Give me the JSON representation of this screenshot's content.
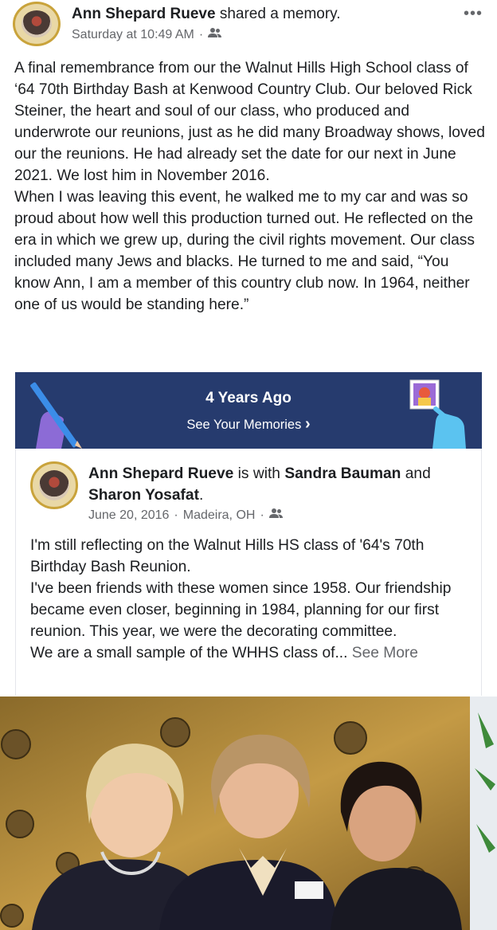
{
  "post": {
    "author": "Ann Shepard Rueve",
    "action": "shared a memory.",
    "timestamp": "Saturday at 10:49 AM",
    "separator": "·",
    "audience_icon": "friends-icon",
    "more_icon": "ellipsis-icon",
    "more_glyph": "•••",
    "body_paragraphs": [
      "A final remembrance from our the Walnut Hills High School class of ‘64 70th Birthday Bash at Kenwood Country Club. Our beloved Rick Steiner, the heart and soul of our class, who produced and underwrote our reunions, just as he did many Broadway shows, loved our the reunions. He had already set the date for our next in June 2021. We lost him in November 2016.",
      "When I was leaving this event, he walked me to my car and was so proud about how well this production turned out. He reflected on the era in which we grew up, during the civil rights movement. Our class included many Jews and blacks. He turned to me and said, “You know Ann, I am a member of this country club now.  In 1964, neither one of us would be standing here.”"
    ]
  },
  "memory_banner": {
    "title": "4 Years Ago",
    "link_label": "See Your Memories",
    "chevron": "›",
    "background": "#263b6e"
  },
  "shared_post": {
    "author": "Ann Shepard Rueve",
    "with_text": "is with",
    "tag1": "Sandra Bauman",
    "and_text": "and",
    "tag2": "Sharon Yosafat",
    "period": ".",
    "date": "June 20, 2016",
    "separator": "·",
    "location": "Madeira, OH",
    "body_lines": [
      "I'm still reflecting on the Walnut Hills HS class of '64's 70th Birthday Bash Reunion.",
      "I've been friends with these women since 1958. Our friendship became even closer, beginning in 1984, planning for our first reunion. This year, we were the decorating committee."
    ],
    "truncated_line": "We are a small sample of the WHHS class of...",
    "see_more": "See More"
  },
  "photo": {
    "description_icon": "reunion-photo"
  }
}
